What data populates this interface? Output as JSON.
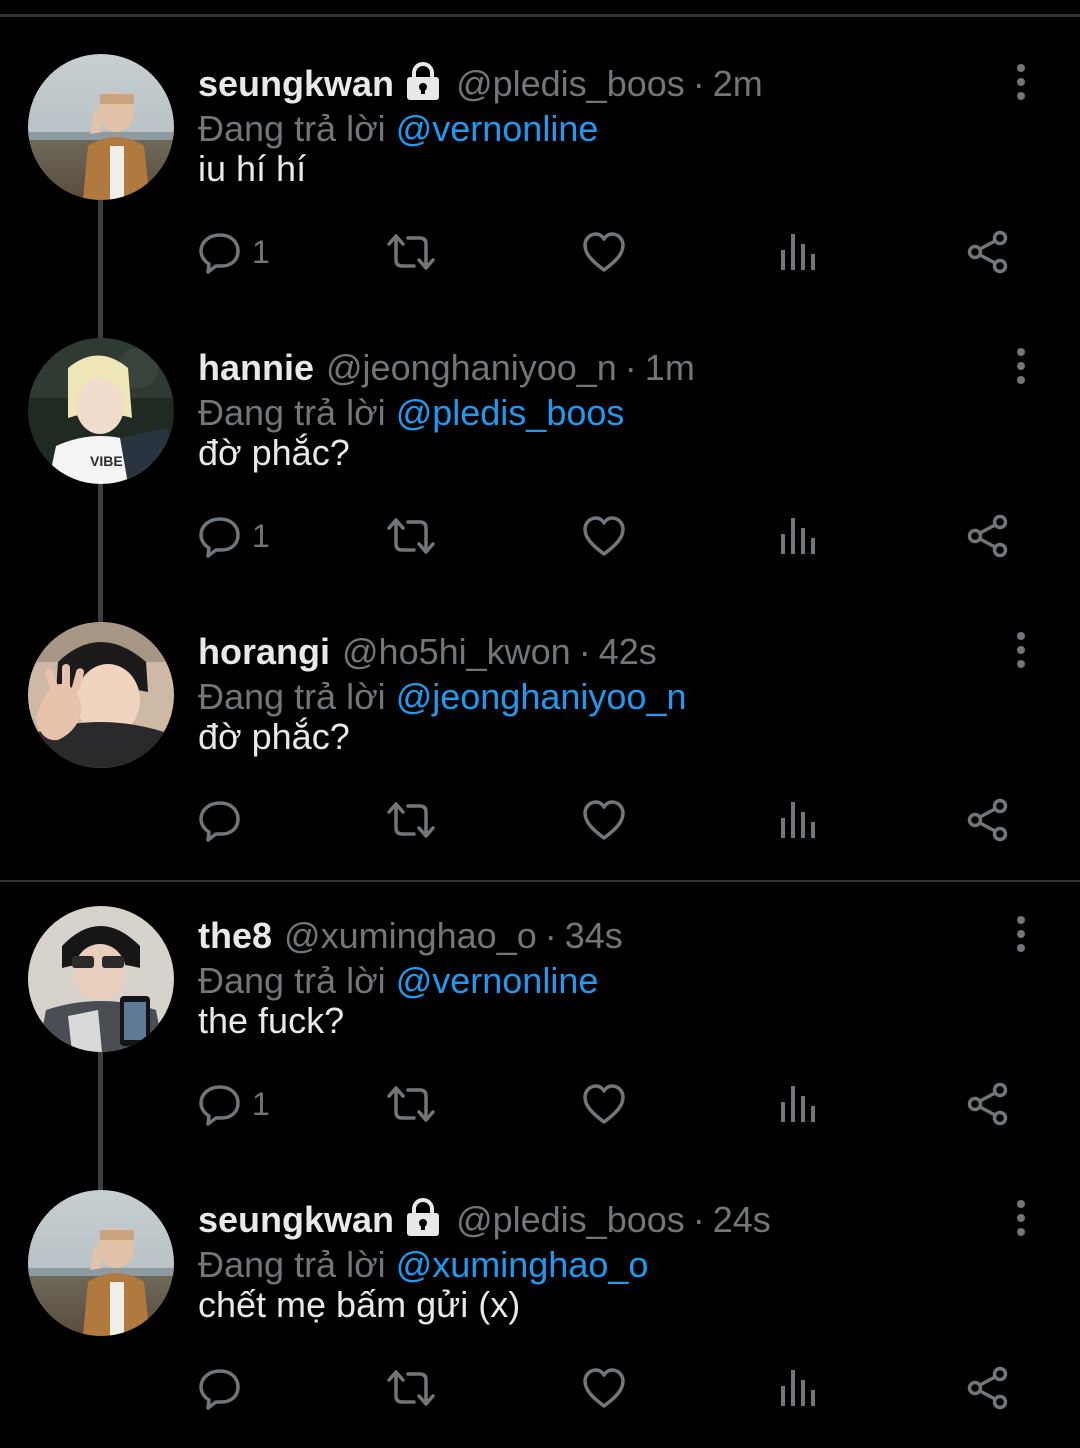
{
  "reply_prefix": "Đang trả lời",
  "colors": {
    "background": "#000000",
    "text": "#e7e9ea",
    "muted": "#71767b",
    "accent": "#1d9bf0"
  },
  "icons": [
    "lock-icon",
    "more-icon",
    "reply-icon",
    "retweet-icon",
    "like-icon",
    "views-icon",
    "share-icon"
  ],
  "tweets": [
    {
      "name": "seungkwan",
      "locked": true,
      "handle": "@pledis_boos",
      "dot": "·",
      "time": "2m",
      "reply_to": "@vernonline",
      "text": "iu hí hí",
      "reply_count": "1"
    },
    {
      "name": "hannie",
      "locked": false,
      "handle": "@jeonghaniyoo_n",
      "dot": "·",
      "time": "1m",
      "reply_to": "@pledis_boos",
      "text": "đờ phắc?",
      "reply_count": "1"
    },
    {
      "name": "horangi",
      "locked": false,
      "handle": "@ho5hi_kwon",
      "dot": "·",
      "time": "42s",
      "reply_to": "@jeonghaniyoo_n",
      "text": "đờ phắc?",
      "reply_count": ""
    },
    {
      "name": "the8",
      "locked": false,
      "handle": "@xuminghao_o",
      "dot": "·",
      "time": "34s",
      "reply_to": "@vernonline",
      "text": "the fuck?",
      "reply_count": "1"
    },
    {
      "name": "seungkwan",
      "locked": true,
      "handle": "@pledis_boos",
      "dot": "·",
      "time": "24s",
      "reply_to": "@xuminghao_o",
      "text": "chết mẹ bấm gửi (x)",
      "reply_count": ""
    }
  ]
}
